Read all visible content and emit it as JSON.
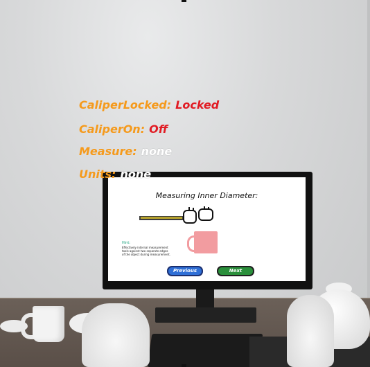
{
  "hud": {
    "caliper_locked": {
      "label": "CaliperLocked:",
      "value": "Locked"
    },
    "caliper_on": {
      "label": "CaliperOn:",
      "value": "Off"
    },
    "measure": {
      "label": "Measure:",
      "value": "none"
    },
    "units": {
      "label": "Units:",
      "value": "none"
    }
  },
  "screen": {
    "title": "Measuring Inner Diameter:",
    "hint_label": "Hint:",
    "hint_text": "Effectively internal measurement tools against two separate edges of the object during measurement.",
    "previous_button": "Previous",
    "next_button": "Next"
  },
  "colors": {
    "hud_label": "#f59a1c",
    "hud_locked": "#e11c24",
    "mug_pink": "#f29ca0",
    "previous_blue": "#2f6fd6",
    "next_green": "#2a8f3b"
  }
}
